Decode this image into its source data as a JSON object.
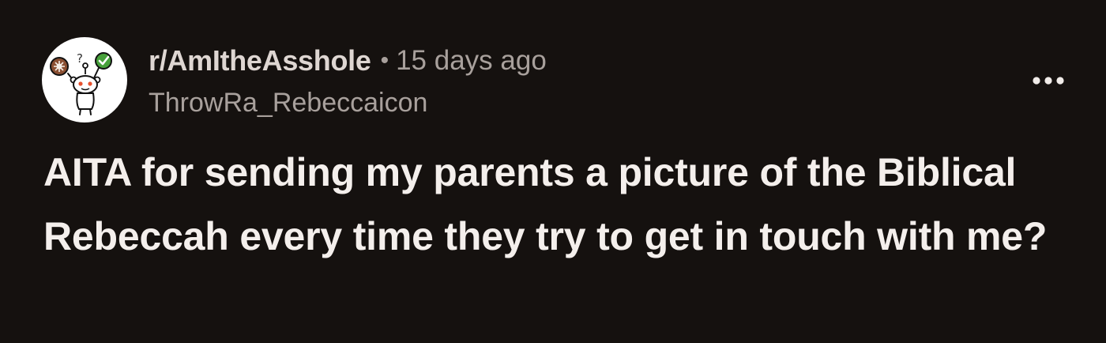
{
  "post": {
    "subreddit": "r/AmItheAsshole",
    "separator": "•",
    "time_ago": "15 days ago",
    "username": "ThrowRa_Rebeccaicon",
    "title": "AITA for sending my parents a picture of the Biblical Rebeccah every time they try to get in touch with me?"
  },
  "icons": {
    "avatar": "subreddit-snoo-avatar",
    "more": "more-options-icon"
  },
  "colors": {
    "background": "#15110f",
    "title_text": "#f4efec",
    "subreddit_text": "#ded6d2",
    "secondary_text": "#a8a09c",
    "avatar_check": "#46a03a",
    "avatar_brown": "#8a4f32"
  }
}
